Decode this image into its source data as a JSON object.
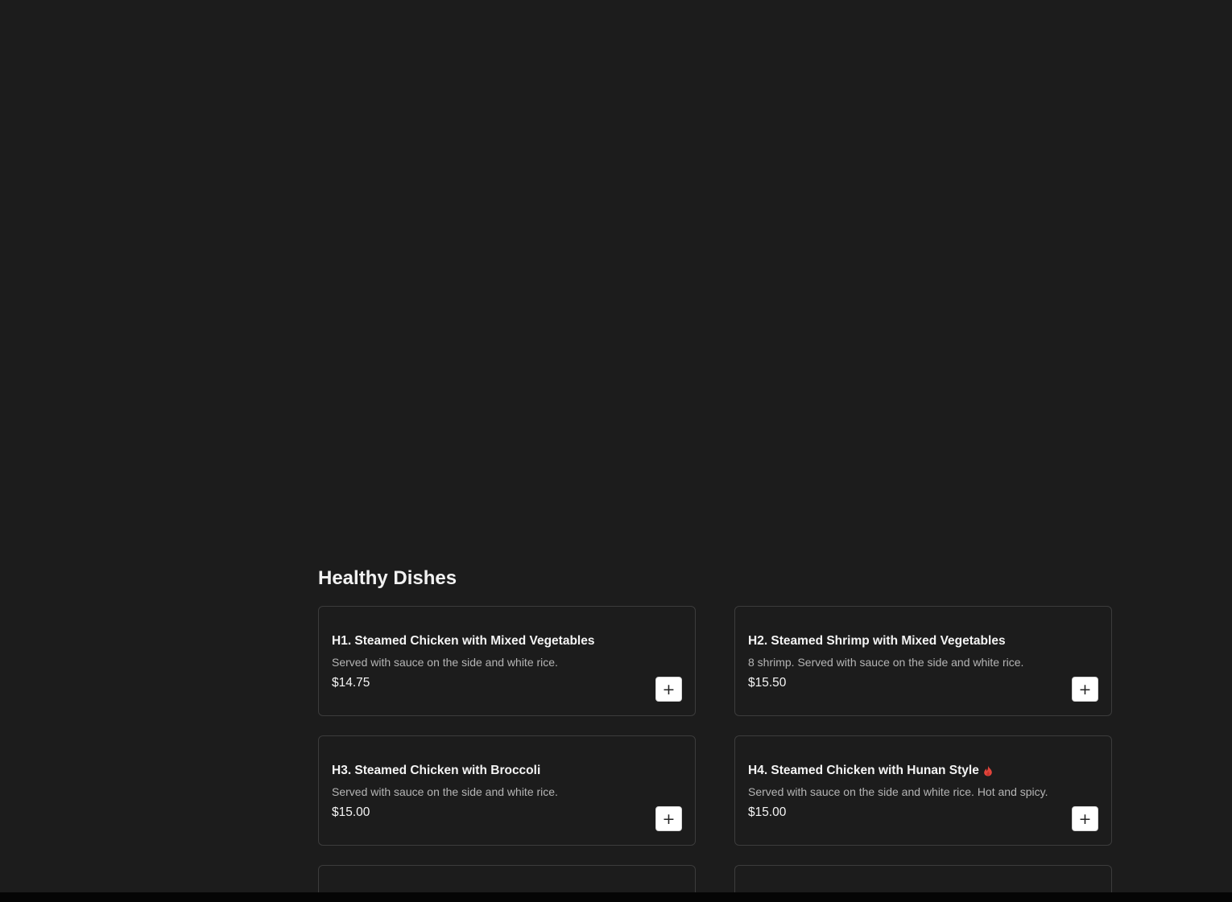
{
  "section": {
    "title": "Healthy Dishes"
  },
  "items": [
    {
      "name": "H1. Steamed Chicken with Mixed Vegetables",
      "description": "Served with sauce on the side and white rice.",
      "price": "$14.75",
      "add_label": "+",
      "spicy": false
    },
    {
      "name": "H2. Steamed Shrimp with Mixed Vegetables",
      "description": "8 shrimp. Served with sauce on the side and white rice.",
      "price": "$15.50",
      "add_label": "+",
      "spicy": false
    },
    {
      "name": "H3. Steamed Chicken with Broccoli",
      "description": "Served with sauce on the side and white rice.",
      "price": "$15.00",
      "add_label": "+",
      "spicy": false
    },
    {
      "name": "H4. Steamed Chicken with Hunan Style",
      "description": "Served with sauce on the side and white rice. Hot and spicy.",
      "price": "$15.00",
      "add_label": "+",
      "spicy": true,
      "spicy_icon": "flame-icon",
      "spicy_color": "#e0443b"
    }
  ],
  "colors": {
    "background": "#1c1c1c",
    "card_border": "#3c3c3c",
    "text_primary": "#f4f4f4",
    "text_secondary": "#b5b5b5",
    "button_bg": "#ffffff"
  }
}
